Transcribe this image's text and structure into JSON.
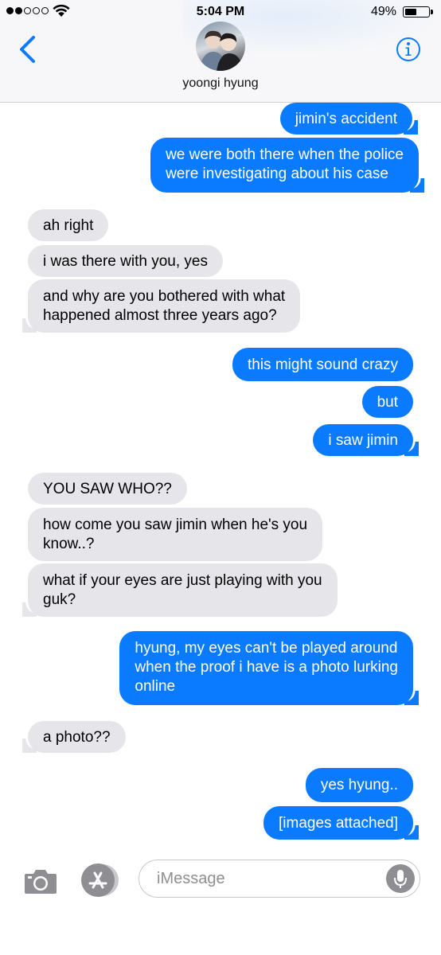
{
  "status": {
    "time": "5:04 PM",
    "battery_pct": "49%"
  },
  "header": {
    "contact_name": "yoongi hyung"
  },
  "messages": [
    {
      "dir": "out",
      "text": "jimin's accident"
    },
    {
      "dir": "out",
      "text": "we were both there when the police\nwere investigating about his case"
    },
    {
      "dir": "in",
      "text": "ah right"
    },
    {
      "dir": "in",
      "text": "i was there with you, yes"
    },
    {
      "dir": "in",
      "text": "and why are you bothered with what\nhappened almost three years ago?"
    },
    {
      "dir": "out",
      "text": "this might sound crazy"
    },
    {
      "dir": "out",
      "text": "but"
    },
    {
      "dir": "out",
      "text": "i saw jimin"
    },
    {
      "dir": "in",
      "text": "YOU SAW WHO??"
    },
    {
      "dir": "in",
      "text": "how come you saw jimin when he's you\nknow..?"
    },
    {
      "dir": "in",
      "text": "what if your eyes are just playing with you\nguk?"
    },
    {
      "dir": "out",
      "text": "hyung, my eyes can't be played around\nwhen the proof i have is a photo lurking\nonline"
    },
    {
      "dir": "in",
      "text": "a photo??"
    },
    {
      "dir": "out",
      "text": "yes hyung.."
    },
    {
      "dir": "out",
      "text": "[images attached]"
    }
  ],
  "input": {
    "placeholder": "iMessage"
  },
  "colors": {
    "outgoing": "#0a7bff",
    "incoming": "#e6e6ea",
    "accent": "#0a7bff"
  }
}
